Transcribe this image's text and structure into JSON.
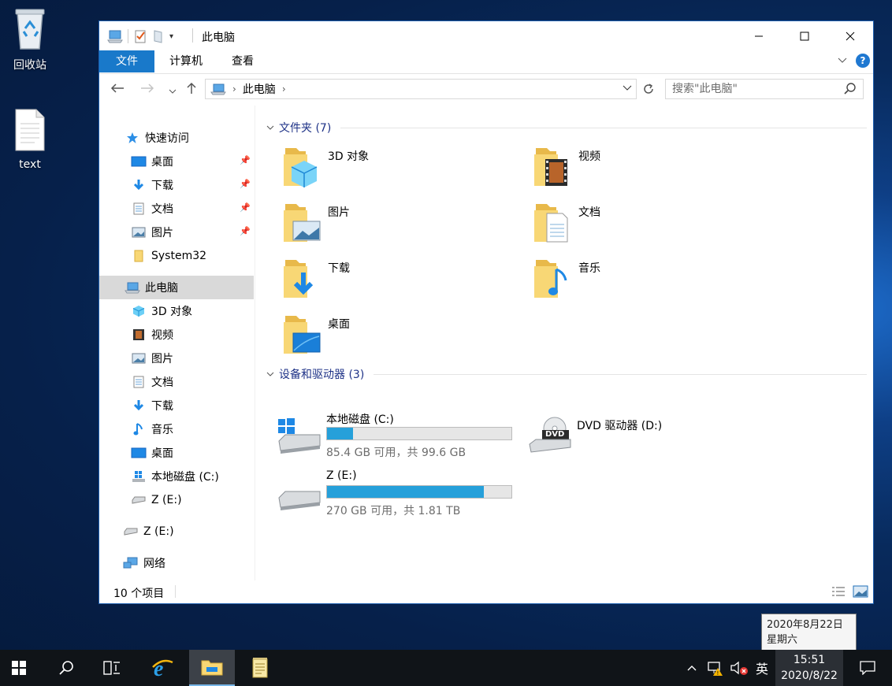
{
  "desktop": {
    "icons": [
      {
        "label": "回收站",
        "icon": "recycle-bin-icon"
      },
      {
        "label": "text",
        "icon": "text-file-icon"
      }
    ]
  },
  "window": {
    "title": "此电脑",
    "ribbon_tabs": [
      "文件",
      "计算机",
      "查看"
    ],
    "help": "?",
    "address": {
      "location": "此电脑"
    },
    "search_placeholder": "搜索\"此电脑\""
  },
  "nav": {
    "quick_access": "快速访问",
    "quick_items": [
      "桌面",
      "下载",
      "文档",
      "图片",
      "System32"
    ],
    "this_pc": "此电脑",
    "pc_items": [
      "3D 对象",
      "视频",
      "图片",
      "文档",
      "下载",
      "音乐",
      "桌面",
      "本地磁盘 (C:)",
      "Z (E:)"
    ],
    "z_drive": "Z (E:)",
    "network": "网络"
  },
  "content": {
    "folders_header": "文件夹 (7)",
    "folders": [
      "3D 对象",
      "视频",
      "图片",
      "文档",
      "下载",
      "音乐",
      "桌面"
    ],
    "devices_header": "设备和驱动器 (3)",
    "drives": [
      {
        "name": "本地磁盘 (C:)",
        "free": "85.4 GB 可用，共 99.6 GB",
        "used_fraction": 0.14
      },
      {
        "name": "DVD 驱动器 (D:)"
      },
      {
        "name": "Z (E:)",
        "free": "270 GB 可用，共 1.81 TB",
        "used_fraction": 0.85
      }
    ]
  },
  "status": {
    "count": "10 个项目"
  },
  "tooltip": {
    "date_full": "2020年8月22日",
    "weekday": "星期六"
  },
  "taskbar": {
    "ime": "英",
    "time": "15:51",
    "date": "2020/8/22"
  },
  "colors": {
    "accent": "#1979ca",
    "folder": "#f8d775",
    "drive_bar": "#26a0da",
    "desktop": "#082a5c"
  }
}
